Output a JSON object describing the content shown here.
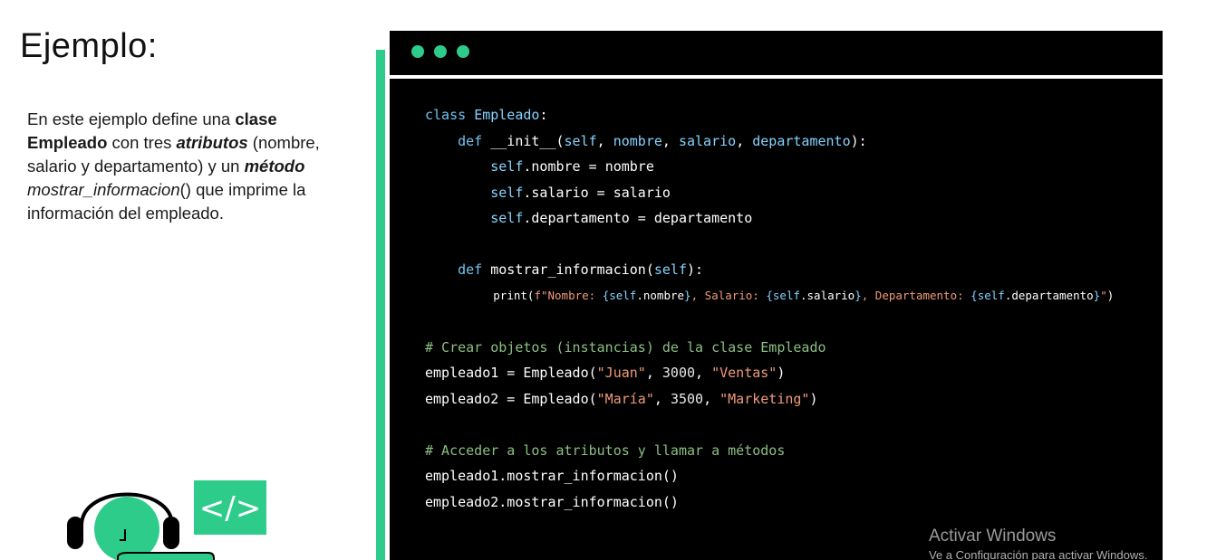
{
  "slide": {
    "title": "Ejemplo:",
    "description": {
      "p1": "En este ejemplo define una ",
      "b1": "clase Empleado",
      "p2": " con tres ",
      "bi1": "atributos",
      "p3": " (nombre, salario y departamento) y un ",
      "bi2": "método",
      "sp": " ",
      "i1": "mostrar_informacion",
      "p4": "() que imprime la información del empleado."
    }
  },
  "code_window": {
    "dots_color": "#2ecc8a",
    "background": "#000000",
    "tokens": {
      "class_kw": "class",
      "class_name": "Empleado",
      "colon": ":",
      "def_kw": "def",
      "init": "__init__",
      "init_params_open": "(",
      "self": "self",
      "nombre": "nombre",
      "salario": "salario",
      "departamento": "departamento",
      "comma": ", ",
      "close_colon": "):",
      "dot": ".",
      "eq": " = ",
      "method": "mostrar_informacion",
      "print_fn": "print",
      "print_open": "(",
      "fstr_1": "f\"Nombre: ",
      "brace_o": "{",
      "brace_c": "}",
      "fstr_2": ", Salario: ",
      "fstr_3": ", Departamento: ",
      "fstr_end": "\"",
      "print_close": ")",
      "comment_1": "# Crear objetos (instancias) de la clase Empleado",
      "emp1": "empleado1",
      "emp2": "empleado2",
      "call_open": " = Empleado(",
      "juan": "\"Juan\"",
      "n3000": "3000",
      "ventas": "\"Ventas\"",
      "maria": "\"María\"",
      "n3500": "3500",
      "marketing": "\"Marketing\"",
      "call_close": ")",
      "comment_2": "# Acceder a los atributos y llamar a métodos",
      "call_method": ".mostrar_informacion()"
    }
  },
  "watermark": {
    "title": "Activar Windows",
    "subtitle": "Ve a Configuración para activar Windows."
  },
  "illustration": {
    "code_badge": "</>",
    "icons": [
      "headset-person-icon",
      "code-brackets-icon"
    ]
  }
}
